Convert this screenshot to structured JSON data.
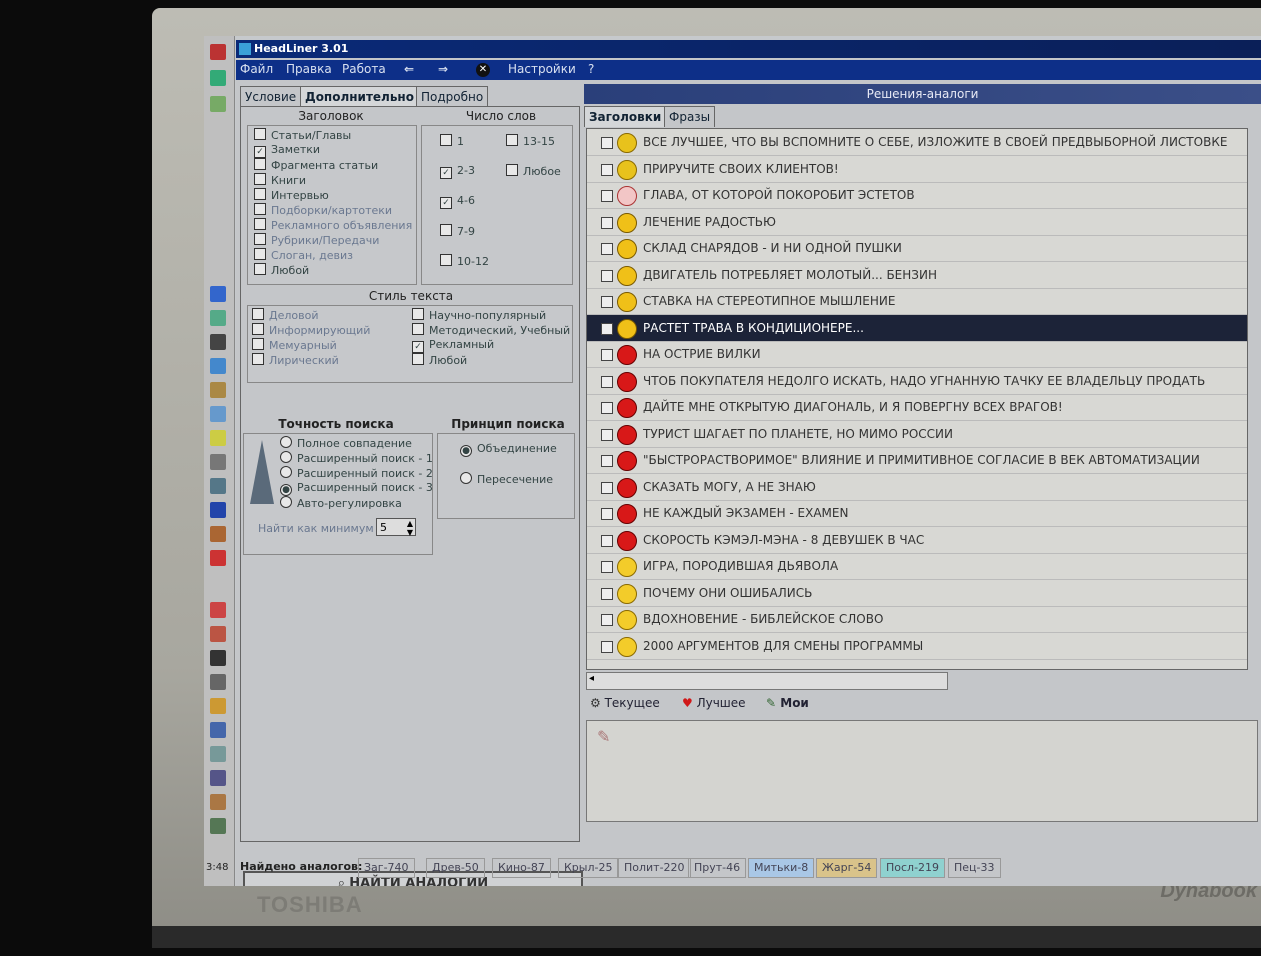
{
  "brand": "TOSHIBA",
  "brand_right": "Dynabook",
  "taskbar": {
    "time": "3:48"
  },
  "window": {
    "title": "HeadLiner 3.01",
    "menu": [
      "Файл",
      "Правка",
      "Работа",
      "Настройки",
      "?"
    ]
  },
  "left_tabs": [
    "Условие",
    "Дополнительно",
    "Подробно"
  ],
  "headings_group": {
    "title": "Заголовок",
    "items": [
      {
        "label": "Статьи/Главы",
        "checked": false
      },
      {
        "label": "Заметки",
        "checked": true
      },
      {
        "label": "Фрагмента статьи",
        "checked": false
      },
      {
        "label": "Книги",
        "checked": false
      },
      {
        "label": "Интервью",
        "checked": false
      },
      {
        "label": "Подборки/картотеки",
        "checked": false
      },
      {
        "label": "Рекламного объявления",
        "checked": false
      },
      {
        "label": "Рубрики/Передачи",
        "checked": false
      },
      {
        "label": "Слоган, девиз",
        "checked": false
      },
      {
        "label": "Любой",
        "checked": false
      }
    ]
  },
  "words_group": {
    "title": "Число слов",
    "items": [
      {
        "label": "1",
        "checked": false
      },
      {
        "label": "13-15",
        "checked": false
      },
      {
        "label": "2-3",
        "checked": true
      },
      {
        "label": "Любое",
        "checked": false
      },
      {
        "label": "4-6",
        "checked": true
      },
      {
        "label": "7-9",
        "checked": false
      },
      {
        "label": "10-12",
        "checked": false
      }
    ]
  },
  "style_group": {
    "title": "Стиль текста",
    "items": [
      {
        "label": "Деловой",
        "checked": false
      },
      {
        "label": "Научно-популярный",
        "checked": false
      },
      {
        "label": "Информирующий",
        "checked": false
      },
      {
        "label": "Методический, Учебный",
        "checked": false
      },
      {
        "label": "Мемуарный",
        "checked": false
      },
      {
        "label": "Рекламный",
        "checked": true
      },
      {
        "label": "Лирический",
        "checked": false
      },
      {
        "label": "Любой",
        "checked": false
      }
    ]
  },
  "accuracy_group": {
    "title": "Точность поиска",
    "options": [
      {
        "label": "Полное совпадение",
        "selected": false
      },
      {
        "label": "Расширенный поиск - 1",
        "selected": false
      },
      {
        "label": "Расширенный поиск - 2",
        "selected": false
      },
      {
        "label": "Расширенный поиск - 3",
        "selected": true
      },
      {
        "label": "Авто-регулировка",
        "selected": false
      }
    ],
    "min_label": "Найти как минимум",
    "min_value": "5"
  },
  "principle_group": {
    "title": "Принцип поиска",
    "options": [
      {
        "label": "Объединение",
        "selected": true
      },
      {
        "label": "Пересечение",
        "selected": false
      }
    ]
  },
  "find_button": "НАЙТИ АНАЛОГИИ",
  "status": {
    "label": "Найдено аналогов:",
    "items": [
      "Заг-740",
      "Древ-50",
      "Кино-87",
      "Крыл-25",
      "Полит-220",
      "Прут-46",
      "Митьки-8",
      "Жарг-54",
      "Посл-219",
      "Пец-33"
    ],
    "colors": [
      "#c7c9cb",
      "#c7c9cb",
      "#c7c9cb",
      "#c7c9cb",
      "#c7c9cb",
      "#c7c9cb",
      "#a9c7e6",
      "#d9c38a",
      "#8fd1cf",
      "#c7c9cb"
    ]
  },
  "right_panel": {
    "title": "Решения-аналоги",
    "tabs": [
      "Заголовки",
      "Фразы"
    ],
    "rows": [
      {
        "text": "ВСЕ ЛУЧШЕЕ, ЧТО ВЫ ВСПОМНИТЕ О СЕБЕ, ИЗЛОЖИТЕ В СВОЕЙ ПРЕДВЫБОРНОЙ ЛИСТОВКЕ",
        "icon": "yellow-arrow-icon"
      },
      {
        "text": "ПРИРУЧИТЕ СВОИХ КЛИЕНТОВ!",
        "icon": "yellow-arrow-icon"
      },
      {
        "text": "ГЛАВА, ОТ КОТОРОЙ ПОКОРОБИТ ЭСТЕТОВ",
        "icon": "person-icon"
      },
      {
        "text": "ЛЕЧЕНИЕ РАДОСТЬЮ",
        "icon": "yellow-plus-icon"
      },
      {
        "text": "СКЛАД СНАРЯДОВ - И НИ ОДНОЙ ПУШКИ",
        "icon": "yellow-plus-icon"
      },
      {
        "text": "ДВИГАТЕЛЬ ПОТРЕБЛЯЕТ МОЛОТЫЙ... БЕНЗИН",
        "icon": "yellow-plus-icon"
      },
      {
        "text": "СТАВКА НА СТЕРЕОТИПНОЕ МЫШЛЕНИЕ",
        "icon": "yellow-plus-icon"
      },
      {
        "text": "РАСТЕТ ТРАВА В КОНДИЦИОНЕРЕ...",
        "icon": "yellow-plus-icon",
        "selected": true
      },
      {
        "text": "НА ОСТРИЕ ВИЛКИ",
        "icon": "red-pie-icon"
      },
      {
        "text": "ЧТОБ ПОКУПАТЕЛЯ НЕДОЛГО ИСКАТЬ, НАДО УГНАННУЮ ТАЧКУ ЕЕ ВЛАДЕЛЬЦУ ПРОДАТЬ",
        "icon": "red-pie-icon"
      },
      {
        "text": "ДАЙТЕ МНЕ ОТКРЫТУЮ ДИАГОНАЛЬ, И Я ПОВЕРГНУ ВСЕХ ВРАГОВ!",
        "icon": "red-pie-icon"
      },
      {
        "text": "ТУРИСТ ШАГАЕТ ПО ПЛАНЕТЕ, НО МИМО РОССИИ",
        "icon": "red-pie-icon"
      },
      {
        "text": "\"БЫСТРОРАСТВОРИМОЕ\" ВЛИЯНИЕ И ПРИМИТИВНОЕ СОГЛАСИЕ В ВЕК АВТОМАТИЗАЦИИ",
        "icon": "red-pie-icon"
      },
      {
        "text": "СКАЗАТЬ МОГУ, А НЕ ЗНАЮ",
        "icon": "red-pie-icon"
      },
      {
        "text": "НЕ КАЖДЫЙ ЭКЗАМЕН - EXAMEN",
        "icon": "red-pie-icon"
      },
      {
        "text": "СКОРОСТЬ КЭМЭЛ-МЭНА - 8 ДЕВУШЕК В ЧАС",
        "icon": "red-pie-icon"
      },
      {
        "text": "ИГРА, ПОРОДИВШАЯ ДЬЯВОЛА",
        "icon": "sun-icon"
      },
      {
        "text": "ПОЧЕМУ ОНИ ОШИБАЛИСЬ",
        "icon": "sun-icon"
      },
      {
        "text": "ВДОХНОВЕНИЕ - БИБЛЕЙСКОЕ СЛОВО",
        "icon": "sun-icon"
      },
      {
        "text": "2000 АРГУМЕНТОВ ДЛЯ СМЕНЫ ПРОГРАММЫ",
        "icon": "sun-icon"
      }
    ],
    "bottom_tabs": [
      {
        "label": "Текущее",
        "icon": "gear-icon"
      },
      {
        "label": "Лучшее",
        "icon": "heart-icon"
      },
      {
        "label": "Мои",
        "icon": "pen-icon"
      }
    ]
  }
}
